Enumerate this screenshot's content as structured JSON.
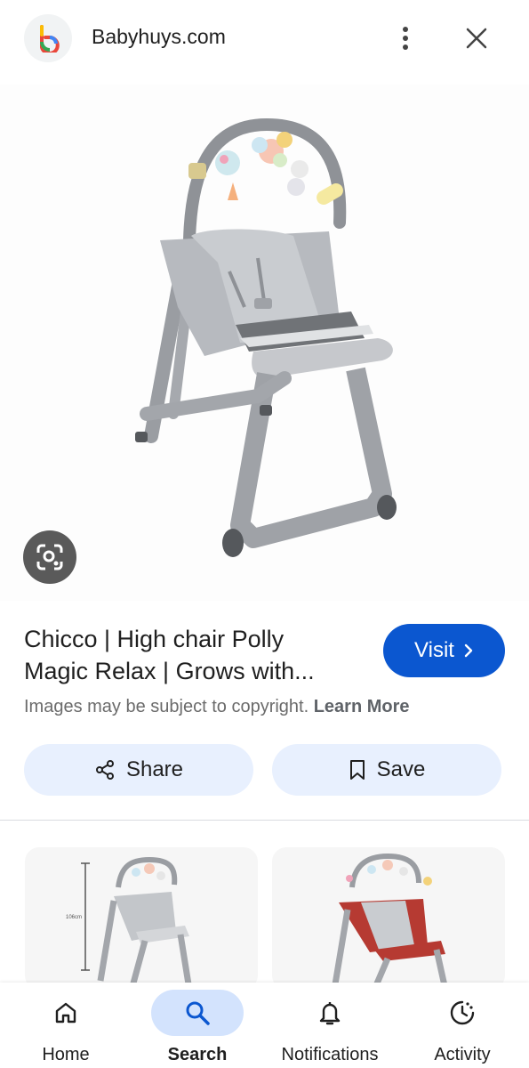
{
  "header": {
    "site_name": "Babyhuys.com",
    "logo_letter": "b",
    "menu_icon": "more-vert-icon",
    "close_icon": "close-icon"
  },
  "result": {
    "title_line1": "Chicco | High chair Polly",
    "title_line2": "Magic Relax | Grows with...",
    "visit_label": "Visit",
    "copyright_text": "Images may be subject to copyright.",
    "learn_more": "Learn More"
  },
  "actions": {
    "share_label": "Share",
    "save_label": "Save"
  },
  "related": {
    "thumb1_height_label": "106cm"
  },
  "bottom_nav": {
    "items": [
      {
        "label": "Home",
        "icon": "home-icon"
      },
      {
        "label": "Search",
        "icon": "search-icon",
        "active": true
      },
      {
        "label": "Notifications",
        "icon": "bell-icon"
      },
      {
        "label": "Activity",
        "icon": "activity-icon"
      }
    ]
  },
  "colors": {
    "visit_button": "#0b57d0",
    "pill_background": "#e8f0fe",
    "active_nav": "#d3e3fd",
    "chair_grey": "#a3a6ab"
  }
}
